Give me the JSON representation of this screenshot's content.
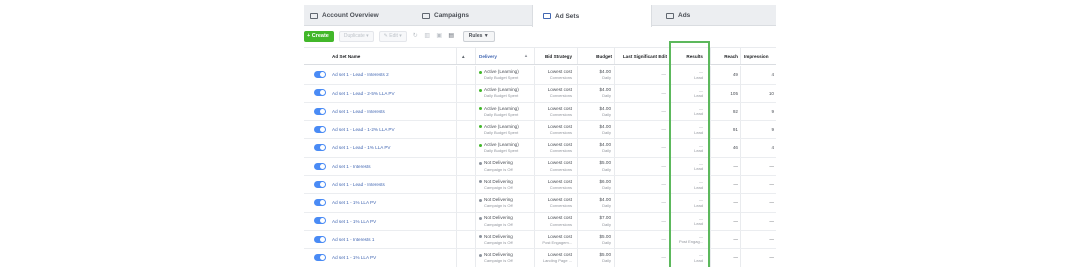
{
  "tabs": [
    {
      "label": "Account Overview",
      "icon": "grid-icon"
    },
    {
      "label": "Campaigns",
      "icon": "folder-icon"
    },
    {
      "label": "Ad Sets",
      "icon": "adsets-icon"
    },
    {
      "label": "Ads",
      "icon": "ad-icon"
    }
  ],
  "toolbar": {
    "create": "+ Create",
    "duplicate": "Duplicate",
    "edit": "Edit",
    "rules": "Rules ▼"
  },
  "headers": {
    "name": "Ad Set Name",
    "delivery": "Delivery",
    "bid": "Bid Strategy",
    "budget": "Budget",
    "edit": "Last Significant Edit",
    "results": "Results",
    "reach": "Reach",
    "impressions": "Impression"
  },
  "rows": [
    {
      "name": "Ad set 1 - Lead - Interests 2",
      "status": "Active (Learning)",
      "status_sub": "Daily Budget Spent",
      "status_color": "#42b72a",
      "bid": "Lowest cost",
      "bid_sub": "Conversions",
      "budget": "$4.00",
      "budget_sub": "Daily",
      "edit": "—",
      "results": "—",
      "results_sub": "Lead",
      "reach": "49",
      "impressions": "4"
    },
    {
      "name": "Ad set 1 - Lead - 2-5% LLA PV",
      "status": "Active (Learning)",
      "status_sub": "Daily Budget Spent",
      "status_color": "#42b72a",
      "bid": "Lowest cost",
      "bid_sub": "Conversions",
      "budget": "$4.00",
      "budget_sub": "Daily",
      "edit": "—",
      "results": "—",
      "results_sub": "Lead",
      "reach": "105",
      "impressions": "10"
    },
    {
      "name": "Ad set 1 - Lead - Interests",
      "status": "Active (Learning)",
      "status_sub": "Daily Budget Spent",
      "status_color": "#42b72a",
      "bid": "Lowest cost",
      "bid_sub": "Conversions",
      "budget": "$4.00",
      "budget_sub": "Daily",
      "edit": "—",
      "results": "—",
      "results_sub": "Lead",
      "reach": "92",
      "impressions": "9"
    },
    {
      "name": "Ad set 1 - Lead - 1-2% LLA PV",
      "status": "Active (Learning)",
      "status_sub": "Daily Budget Spent",
      "status_color": "#42b72a",
      "bid": "Lowest cost",
      "bid_sub": "Conversions",
      "budget": "$4.00",
      "budget_sub": "Daily",
      "edit": "—",
      "results": "—",
      "results_sub": "Lead",
      "reach": "91",
      "impressions": "9"
    },
    {
      "name": "Ad set 1 - Lead - 1% LLA PV",
      "status": "Active (Learning)",
      "status_sub": "Daily Budget Spent",
      "status_color": "#42b72a",
      "bid": "Lowest cost",
      "bid_sub": "Conversions",
      "budget": "$4.00",
      "budget_sub": "Daily",
      "edit": "—",
      "results": "—",
      "results_sub": "Lead",
      "reach": "46",
      "impressions": "4"
    },
    {
      "name": "Ad set 1 - Interests",
      "status": "Not Delivering",
      "status_sub": "Campaign is Off",
      "status_color": "#8d949e",
      "bid": "Lowest cost",
      "bid_sub": "Conversions",
      "budget": "$5.00",
      "budget_sub": "Daily",
      "edit": "—",
      "results": "—",
      "results_sub": "Lead",
      "reach": "—",
      "impressions": "—"
    },
    {
      "name": "Ad set 1 - Lead - Interests",
      "status": "Not Delivering",
      "status_sub": "Campaign is Off",
      "status_color": "#8d949e",
      "bid": "Lowest cost",
      "bid_sub": "Conversions",
      "budget": "$6.00",
      "budget_sub": "Daily",
      "edit": "—",
      "results": "—",
      "results_sub": "Lead",
      "reach": "—",
      "impressions": "—"
    },
    {
      "name": "Ad set 1 - 1% LLA PV",
      "status": "Not Delivering",
      "status_sub": "Campaign is Off",
      "status_color": "#8d949e",
      "bid": "Lowest cost",
      "bid_sub": "Conversions",
      "budget": "$4.00",
      "budget_sub": "Daily",
      "edit": "—",
      "results": "—",
      "results_sub": "Lead",
      "reach": "—",
      "impressions": "—"
    },
    {
      "name": "Ad set 1 - 1% LLA PV",
      "status": "Not Delivering",
      "status_sub": "Campaign is Off",
      "status_color": "#8d949e",
      "bid": "Lowest cost",
      "bid_sub": "Conversions",
      "budget": "$7.00",
      "budget_sub": "Daily",
      "edit": "—",
      "results": "—",
      "results_sub": "Lead",
      "reach": "—",
      "impressions": "—"
    },
    {
      "name": "Ad set 1 - Interests 1",
      "status": "Not Delivering",
      "status_sub": "Campaign is Off",
      "status_color": "#8d949e",
      "bid": "Lowest cost",
      "bid_sub": "Post Engagem...",
      "budget": "$5.00",
      "budget_sub": "Daily",
      "edit": "—",
      "results": "—",
      "results_sub": "Post Engag...",
      "reach": "—",
      "impressions": "—"
    },
    {
      "name": "Ad set 1 - 1% LLA PV",
      "status": "Not Delivering",
      "status_sub": "Campaign is Off",
      "status_color": "#8d949e",
      "bid": "Lowest cost",
      "bid_sub": "Landing Page ...",
      "budget": "$5.00",
      "budget_sub": "Daily",
      "edit": "—",
      "results": "—",
      "results_sub": "Lead",
      "reach": "—",
      "impressions": "—"
    }
  ]
}
